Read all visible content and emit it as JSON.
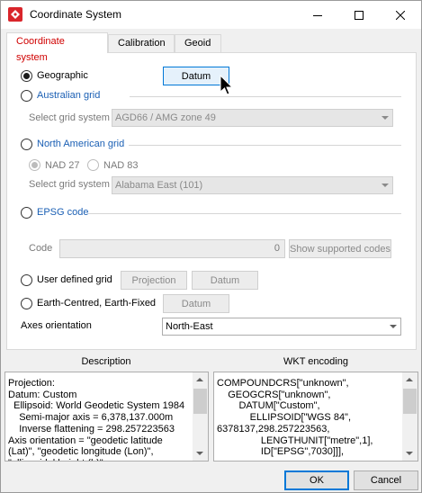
{
  "window": {
    "title": "Coordinate System"
  },
  "tabs": [
    {
      "label": "Coordinate system"
    },
    {
      "label": "Calibration"
    },
    {
      "label": "Geoid"
    }
  ],
  "geographic": {
    "label": "Geographic",
    "datum_button": "Datum"
  },
  "australian": {
    "label": "Australian grid",
    "select_label": "Select grid system",
    "select_value": "AGD66 / AMG zone 49"
  },
  "north_american": {
    "label": "North American grid",
    "nad27": "NAD 27",
    "nad83": "NAD 83",
    "select_label": "Select grid system",
    "select_value": "Alabama East (101)"
  },
  "epsg": {
    "label": "EPSG code",
    "code_label": "Code",
    "code_value": "0",
    "show_button": "Show supported codes"
  },
  "user_defined": {
    "label": "User defined grid",
    "projection_button": "Projection",
    "datum_button": "Datum"
  },
  "ecef": {
    "label": "Earth-Centred, Earth-Fixed",
    "datum_button": "Datum"
  },
  "axes": {
    "label": "Axes orientation",
    "value": "North-East"
  },
  "description": {
    "heading": "Description",
    "text": "Projection:\nDatum: Custom\n  Ellipsoid: World Geodetic System 1984\n    Semi-major axis = 6,378,137.000m\n    Inverse flattening = 298.257223563\nAxis orientation = \"geodetic latitude\n(Lat)\", \"geodetic longitude (Lon)\",\n\"ellipsoidal height (h)\""
  },
  "wkt": {
    "heading": "WKT encoding",
    "text": "COMPOUNDCRS[\"unknown\",\n    GEOGCRS[\"unknown\",\n        DATUM[\"Custom\",\n            ELLIPSOID[\"WGS 84\",\n6378137,298.257223563,\n                LENGTHUNIT[\"metre\",1],\n                ID[\"EPSG\",7030]]],"
  },
  "footer": {
    "ok": "OK",
    "cancel": "Cancel"
  },
  "colors": {
    "active_tab": "#d00000",
    "link_blue": "#1a5fb4",
    "focus_border": "#0078d7"
  }
}
